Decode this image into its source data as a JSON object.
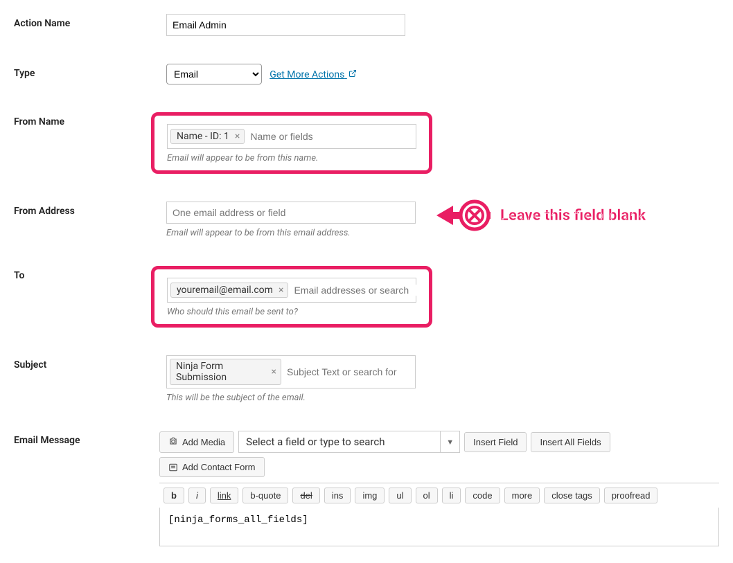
{
  "actionName": {
    "label": "Action Name",
    "value": "Email Admin"
  },
  "type": {
    "label": "Type",
    "selected": "Email",
    "moreLink": "Get More Actions"
  },
  "fromName": {
    "label": "From Name",
    "tag": "Name - ID: 1",
    "placeholder": "Name or fields",
    "helper": "Email will appear to be from this name."
  },
  "fromAddress": {
    "label": "From Address",
    "placeholder": "One email address or field",
    "helper": "Email will appear to be from this email address.",
    "annotation": "Leave this field blank"
  },
  "to": {
    "label": "To",
    "tag": "youremail@email.com",
    "placeholder": "Email addresses or search",
    "helper": "Who should this email be sent to?"
  },
  "subject": {
    "label": "Subject",
    "tag": "Ninja Form Submission",
    "placeholder": "Subject Text or search for",
    "helper": "This will be the subject of the email."
  },
  "emailMessage": {
    "label": "Email Message",
    "addMedia": "Add Media",
    "searchPlaceholder": "Select a field or type to search",
    "insertField": "Insert Field",
    "insertAllFields": "Insert All Fields",
    "addContactForm": "Add Contact Form",
    "quicktags": [
      "b",
      "i",
      "link",
      "b-quote",
      "del",
      "ins",
      "img",
      "ul",
      "ol",
      "li",
      "code",
      "more",
      "close tags",
      "proofread"
    ],
    "content": "[ninja_forms_all_fields]"
  }
}
